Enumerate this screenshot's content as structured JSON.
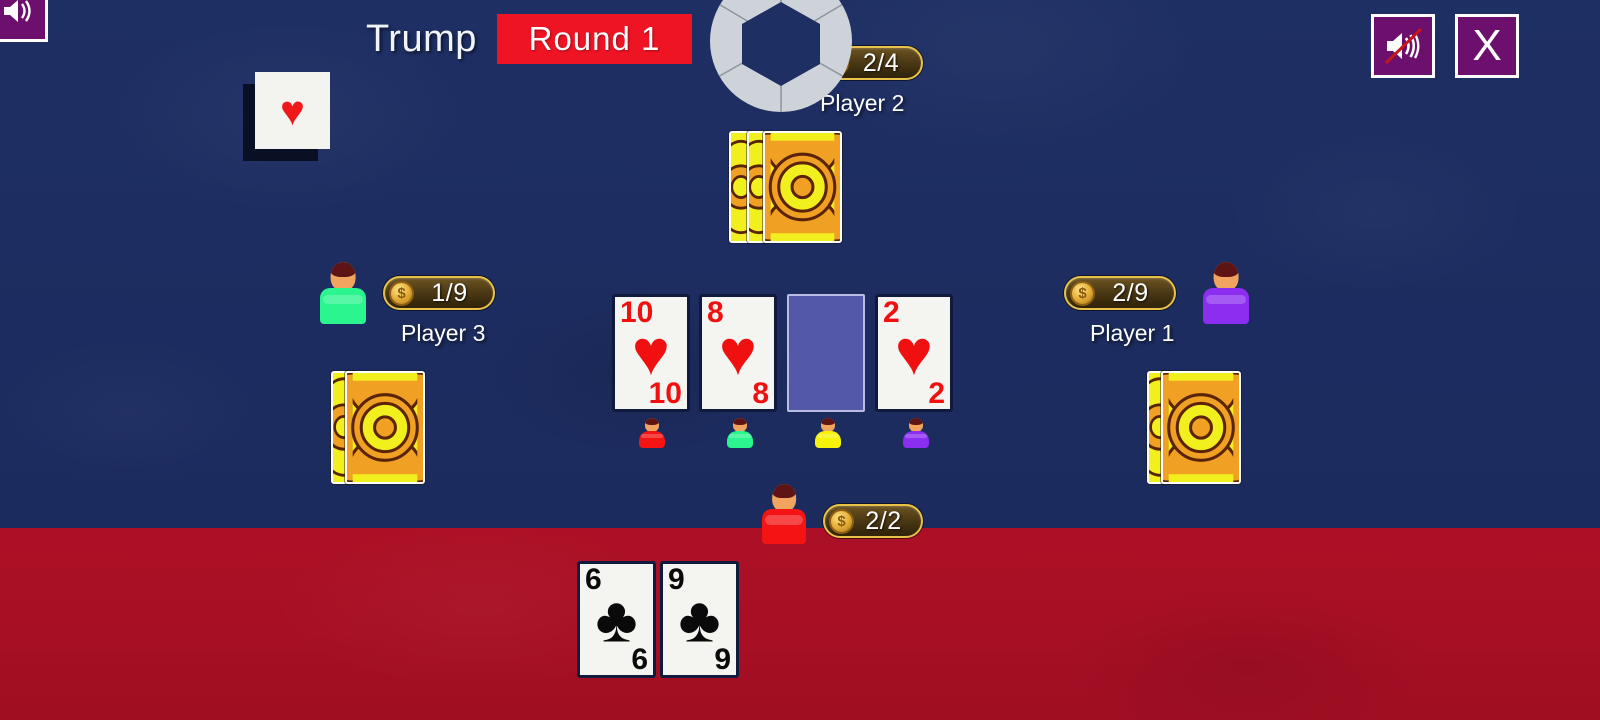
{
  "header": {
    "trump_label": "Trump",
    "round_label": "Round  1",
    "round_badge_color": "#ef1424",
    "trump_suit": "hearts",
    "trump_suit_glyph": "♥"
  },
  "controls": {
    "corner_sound_icon": "sound-icon",
    "mute_label": "mute-icon",
    "close_label": "X"
  },
  "players": [
    {
      "id": "player2",
      "name": "Player 2",
      "score": "2/4",
      "color": "#f7f209",
      "position": "top",
      "hand_back_count": 3,
      "highlighted": true
    },
    {
      "id": "player3",
      "name": "Player 3",
      "score": "1/9",
      "color": "#2af58f",
      "position": "left",
      "hand_back_count": 2,
      "highlighted": false
    },
    {
      "id": "player1",
      "name": "Player 1",
      "score": "2/9",
      "color": "#8b2ef0",
      "position": "right",
      "hand_back_count": 2,
      "highlighted": false
    },
    {
      "id": "player0",
      "name": "",
      "score": "2/2",
      "color": "#f51414",
      "position": "bottom",
      "hand_back_count": 0,
      "highlighted": false
    }
  ],
  "trick": {
    "slots": [
      {
        "rank": "10",
        "suit": "♥",
        "color": "red",
        "empty": false,
        "owner_color": "#f51414"
      },
      {
        "rank": "8",
        "suit": "♥",
        "color": "red",
        "empty": false,
        "owner_color": "#2af58f"
      },
      {
        "rank": "",
        "suit": "",
        "color": "",
        "empty": true,
        "owner_color": "#f7f209"
      },
      {
        "rank": "2",
        "suit": "♥",
        "color": "red",
        "empty": false,
        "owner_color": "#8b2ef0"
      }
    ]
  },
  "hand": {
    "cards": [
      {
        "rank": "6",
        "suit": "♣",
        "color": "black"
      },
      {
        "rank": "9",
        "suit": "♣",
        "color": "black"
      }
    ]
  },
  "theme": {
    "felt_top": "#1e2f64",
    "felt_bottom": "#ad1026",
    "badge_border": "#e8c24a",
    "card_back_bg": "#f2ef1e",
    "card_back_accent": "#f0a022",
    "empty_slot": "#5359a8"
  }
}
